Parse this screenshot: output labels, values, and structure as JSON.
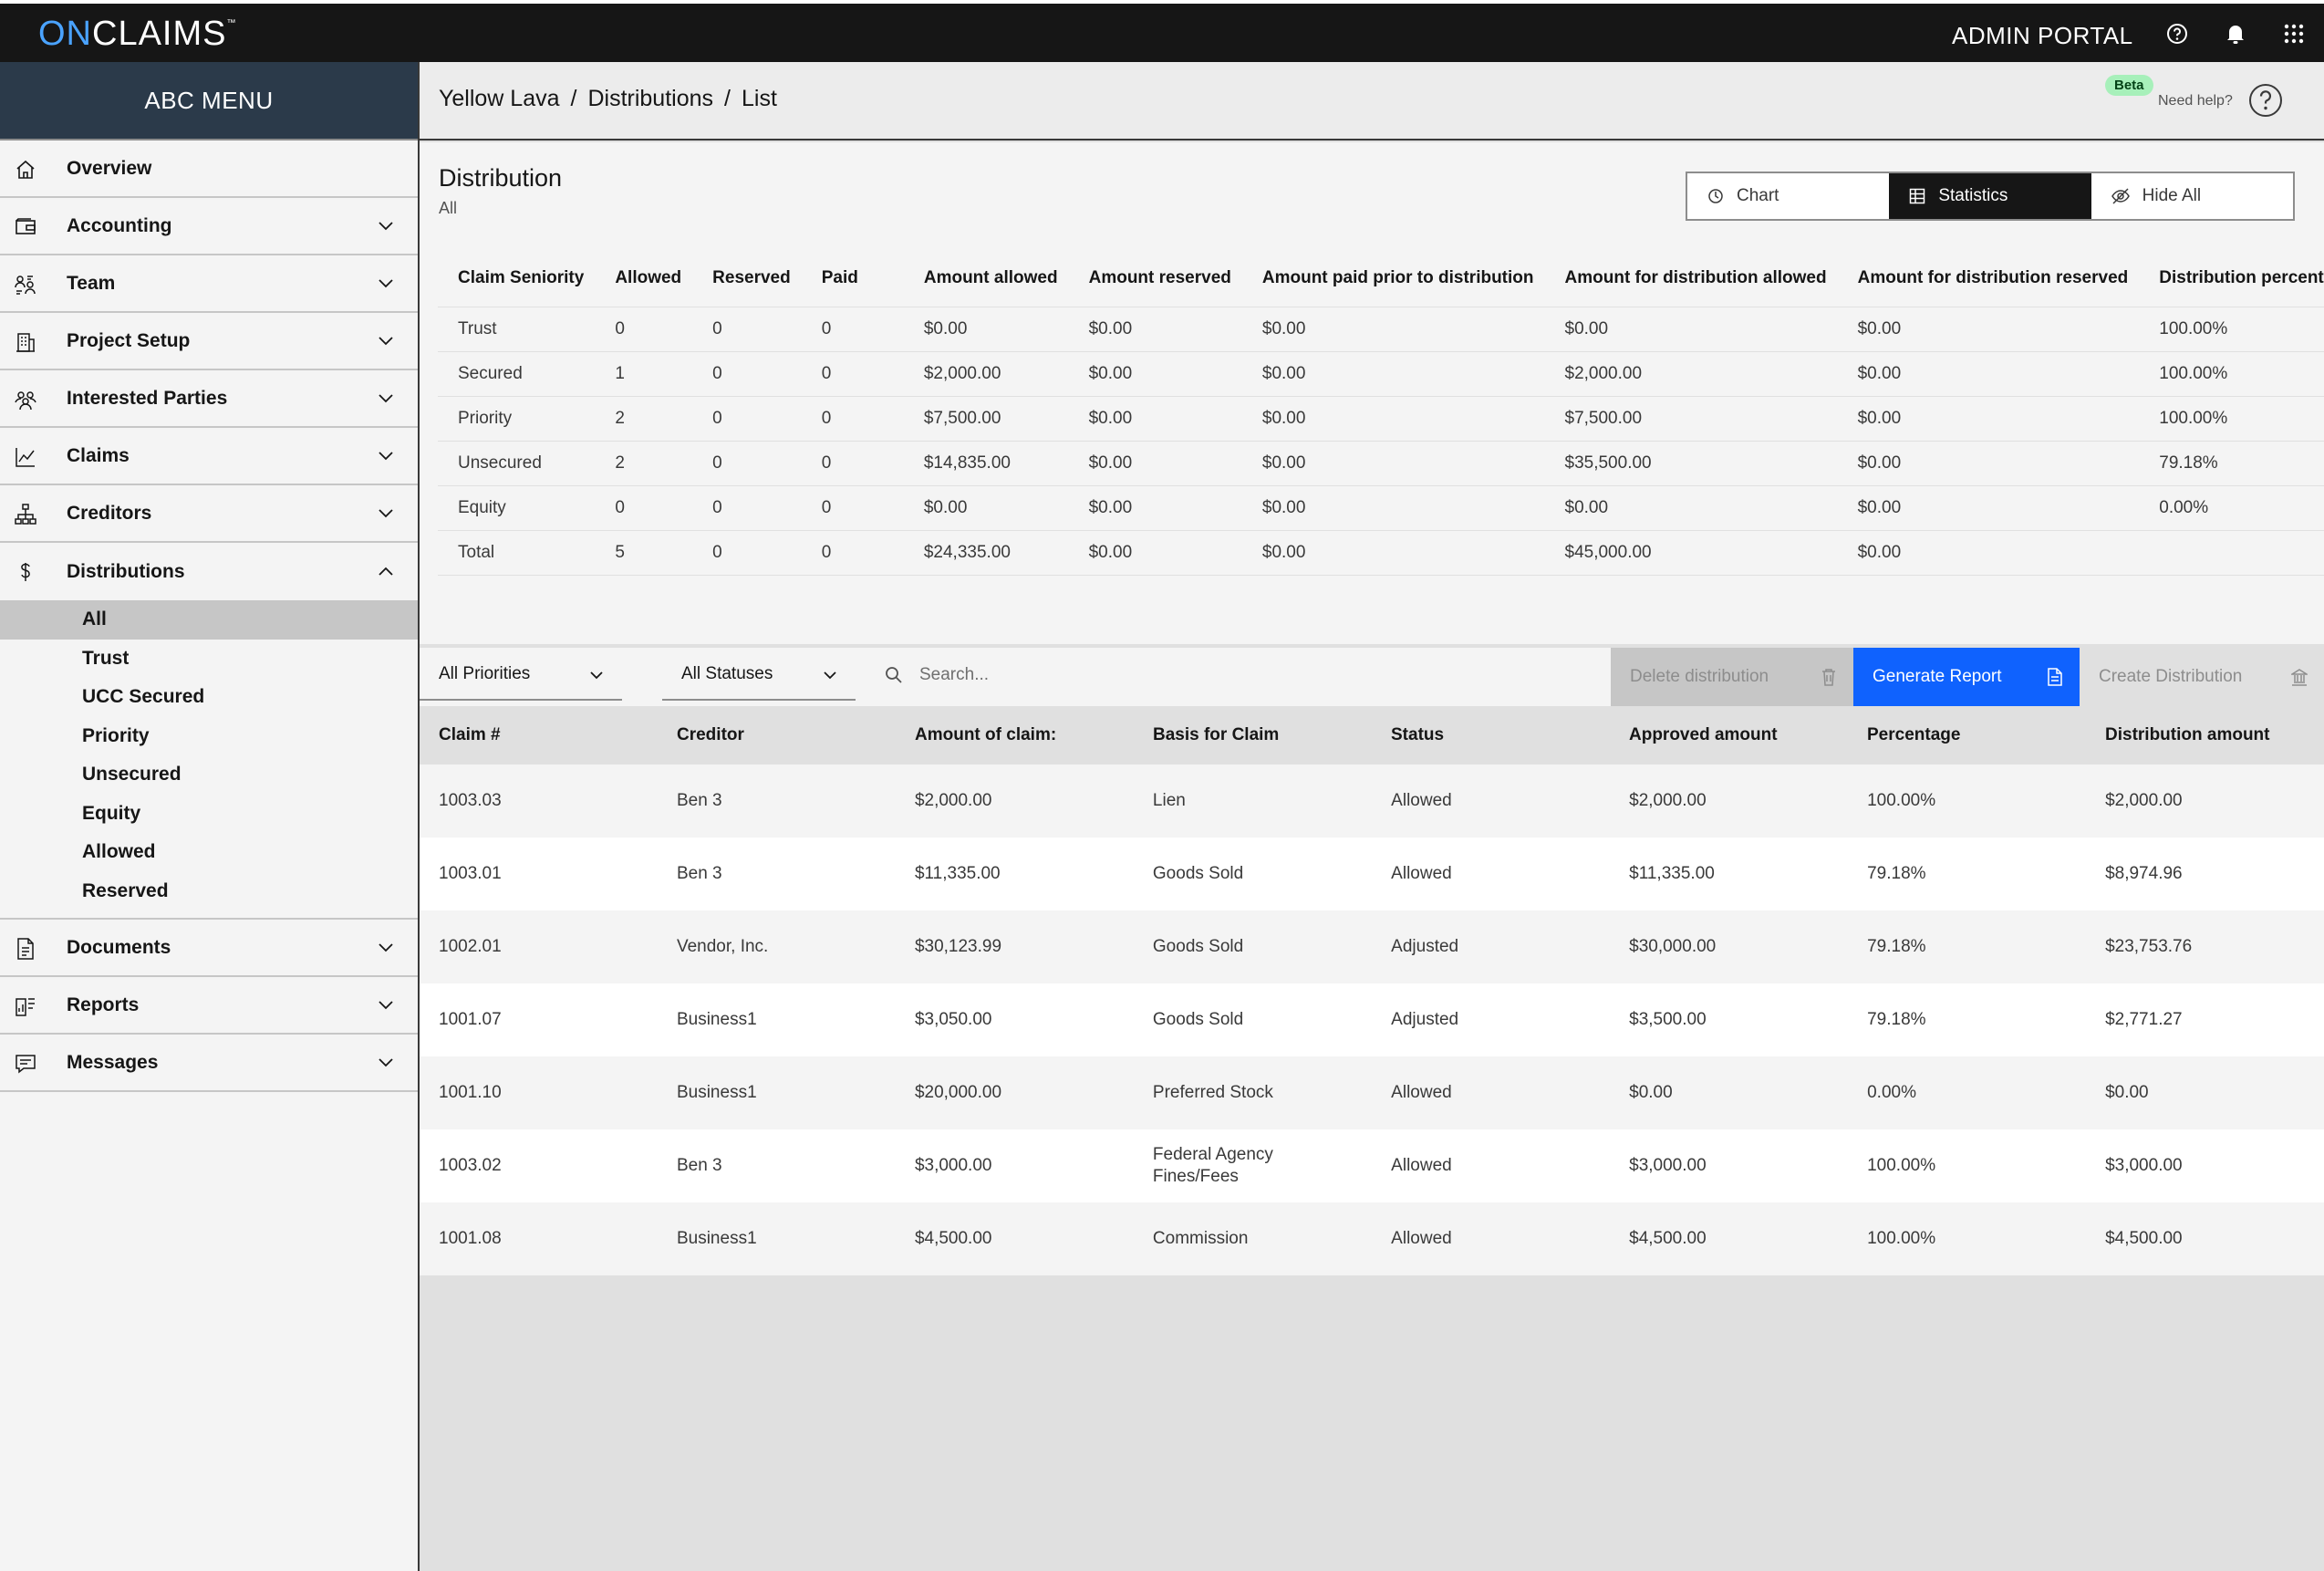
{
  "topbar": {
    "logo_on": "ON",
    "logo_claims": "CLAIMS",
    "logo_tm": "™",
    "portal_title": "ADMIN PORTAL",
    "icons": [
      "help-icon",
      "bell-icon",
      "apps-grid-icon"
    ]
  },
  "sidebar": {
    "title": "ABC MENU",
    "items": [
      {
        "label": "Overview",
        "icon": "home-icon"
      },
      {
        "label": "Accounting",
        "icon": "wallet-icon"
      },
      {
        "label": "Team",
        "icon": "team-icon"
      },
      {
        "label": "Project Setup",
        "icon": "building-icon"
      },
      {
        "label": "Interested Parties",
        "icon": "people-icon"
      },
      {
        "label": "Claims",
        "icon": "chart-line-icon"
      },
      {
        "label": "Creditors",
        "icon": "hierarchy-icon"
      },
      {
        "label": "Distributions",
        "icon": "dollar-icon"
      },
      {
        "label": "Documents",
        "icon": "document-icon"
      },
      {
        "label": "Reports",
        "icon": "report-icon"
      },
      {
        "label": "Messages",
        "icon": "chat-icon"
      }
    ],
    "distributions_sub": [
      "All",
      "Trust",
      "UCC Secured",
      "Priority",
      "Unsecured",
      "Equity",
      "Allowed",
      "Reserved"
    ],
    "active_sub": "All"
  },
  "breadcrumb": {
    "parts": [
      "Yellow Lava",
      "Distributions",
      "List"
    ],
    "separator": "/"
  },
  "help": {
    "beta": "Beta",
    "need_help": "Need help?"
  },
  "distribution": {
    "title": "Distribution",
    "subtitle": "All",
    "toggles": [
      {
        "label": "Chart",
        "icon": "clock-icon",
        "active": false
      },
      {
        "label": "Statistics",
        "icon": "table-icon",
        "active": true
      },
      {
        "label": "Hide All",
        "icon": "eye-off-icon",
        "active": false
      }
    ]
  },
  "stats": {
    "headers": [
      "Claim Seniority",
      "Allowed",
      "Reserved",
      "Paid",
      "Amount allowed",
      "Amount reserved",
      "Amount paid prior to distribution",
      "Amount for distribution allowed",
      "Amount for distribution reserved",
      "Distribution percentage"
    ],
    "rows": [
      [
        "Trust",
        "0",
        "0",
        "0",
        "$0.00",
        "$0.00",
        "$0.00",
        "$0.00",
        "$0.00",
        "100.00%"
      ],
      [
        "Secured",
        "1",
        "0",
        "0",
        "$2,000.00",
        "$0.00",
        "$0.00",
        "$2,000.00",
        "$0.00",
        "100.00%"
      ],
      [
        "Priority",
        "2",
        "0",
        "0",
        "$7,500.00",
        "$0.00",
        "$0.00",
        "$7,500.00",
        "$0.00",
        "100.00%"
      ],
      [
        "Unsecured",
        "2",
        "0",
        "0",
        "$14,835.00",
        "$0.00",
        "$0.00",
        "$35,500.00",
        "$0.00",
        "79.18%"
      ],
      [
        "Equity",
        "0",
        "0",
        "0",
        "$0.00",
        "$0.00",
        "$0.00",
        "$0.00",
        "$0.00",
        "0.00%"
      ],
      [
        "Total",
        "5",
        "0",
        "0",
        "$24,335.00",
        "$0.00",
        "$0.00",
        "$45,000.00",
        "$0.00",
        ""
      ]
    ]
  },
  "filters": {
    "priority": "All Priorities",
    "status": "All Statuses",
    "search_placeholder": "Search...",
    "delete_label": "Delete distribution",
    "generate_label": "Generate Report",
    "create_label": "Create Distribution"
  },
  "claims": {
    "headers": [
      "Claim #",
      "Creditor",
      "Amount of claim:",
      "Basis for Claim",
      "Status",
      "Approved amount",
      "Percentage",
      "Distribution amount"
    ],
    "rows": [
      [
        "1003.03",
        "Ben 3",
        "$2,000.00",
        "Lien",
        "Allowed",
        "$2,000.00",
        "100.00%",
        "$2,000.00"
      ],
      [
        "1003.01",
        "Ben 3",
        "$11,335.00",
        "Goods Sold",
        "Allowed",
        "$11,335.00",
        "79.18%",
        "$8,974.96"
      ],
      [
        "1002.01",
        "Vendor, Inc.",
        "$30,123.99",
        "Goods Sold",
        "Adjusted",
        "$30,000.00",
        "79.18%",
        "$23,753.76"
      ],
      [
        "1001.07",
        "Business1",
        "$3,050.00",
        "Goods Sold",
        "Adjusted",
        "$3,500.00",
        "79.18%",
        "$2,771.27"
      ],
      [
        "1001.10",
        "Business1",
        "$20,000.00",
        "Preferred Stock",
        "Allowed",
        "$0.00",
        "0.00%",
        "$0.00"
      ],
      [
        "1003.02",
        "Ben 3",
        "$3,000.00",
        "Federal Agency Fines/Fees",
        "Allowed",
        "$3,000.00",
        "100.00%",
        "$3,000.00"
      ],
      [
        "1001.08",
        "Business1",
        "$4,500.00",
        "Commission",
        "Allowed",
        "$4,500.00",
        "100.00%",
        "$4,500.00"
      ]
    ]
  }
}
